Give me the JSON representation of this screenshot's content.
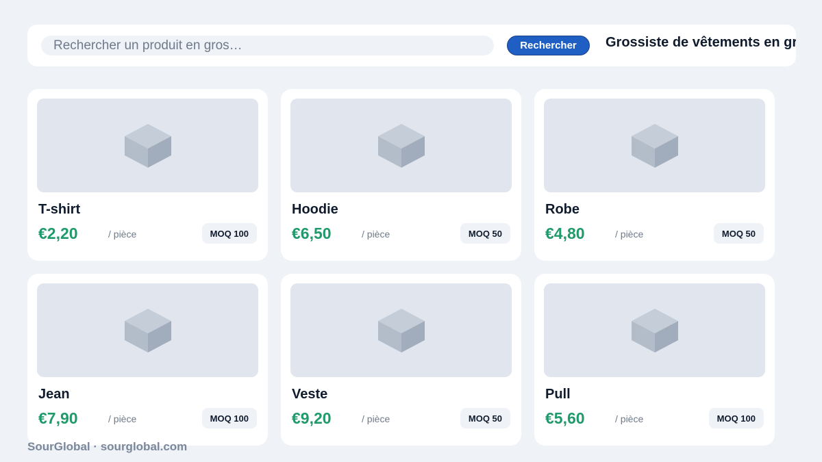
{
  "search": {
    "placeholder": "Rechercher un produit en gros…",
    "button_label": "Rechercher"
  },
  "page_title": "Grossiste de vêtements en gros",
  "icons": {
    "product_placeholder": "cube-icon"
  },
  "colors": {
    "background": "#eff2f7",
    "accent": "#1f5fc4",
    "price": "#1f9a6b",
    "text": "#0f1b2d",
    "muted": "#6e7a8a"
  },
  "products": [
    {
      "name": "T-shirt",
      "price": "€2,20",
      "unit": "/ pièce",
      "moq": "MOQ 100"
    },
    {
      "name": "Hoodie",
      "price": "€6,50",
      "unit": "/ pièce",
      "moq": "MOQ 50"
    },
    {
      "name": "Robe",
      "price": "€4,80",
      "unit": "/ pièce",
      "moq": "MOQ 50"
    },
    {
      "name": "Jean",
      "price": "€7,90",
      "unit": "/ pièce",
      "moq": "MOQ 100"
    },
    {
      "name": "Veste",
      "price": "€9,20",
      "unit": "/ pièce",
      "moq": "MOQ 50"
    },
    {
      "name": "Pull",
      "price": "€5,60",
      "unit": "/ pièce",
      "moq": "MOQ 100"
    }
  ],
  "footer": "SourGlobal · sourglobal.com"
}
